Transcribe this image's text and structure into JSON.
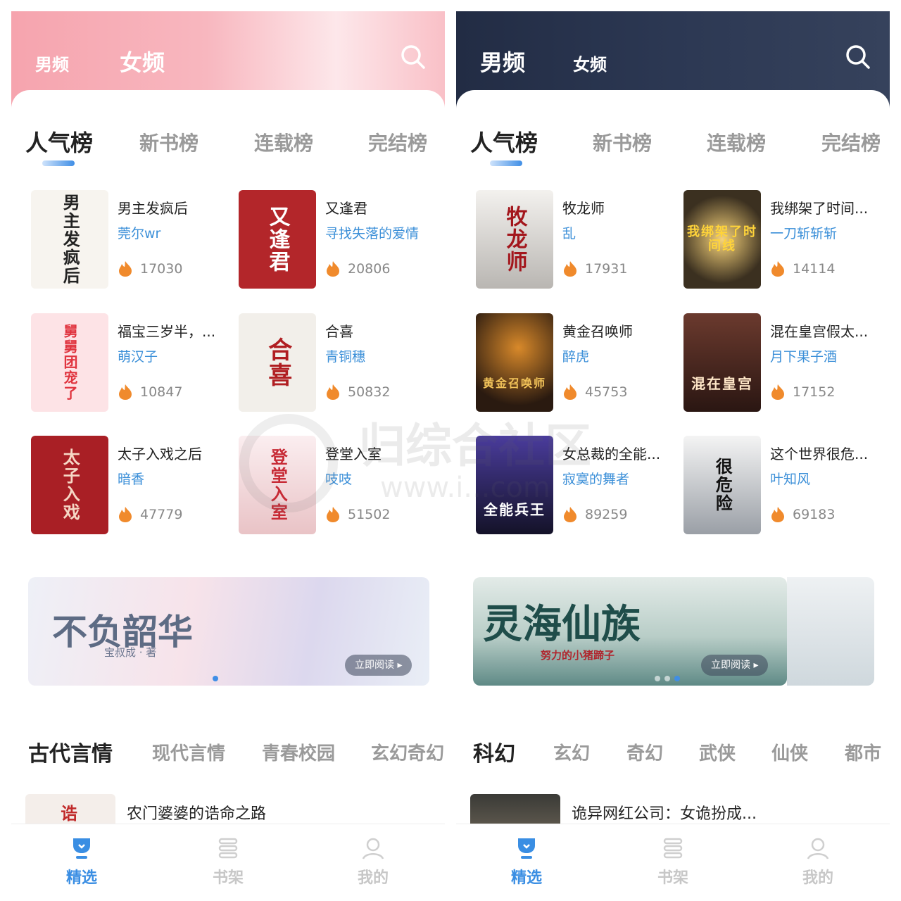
{
  "colors": {
    "accent": "#3a8ee3",
    "female_header": "#f6a4ae",
    "male_header": "#222c44",
    "heat": "#f08a2c"
  },
  "watermark": {
    "text": "归综合社区",
    "url": "www.i...com"
  },
  "panels": [
    {
      "gender_tabs": [
        "男频",
        "女频"
      ],
      "active_gender": "女频",
      "rank_tabs": [
        "人气榜",
        "新书榜",
        "连载榜",
        "完结榜"
      ],
      "books": [
        {
          "title": "男主发疯后",
          "author": "莞尔wr",
          "heat": "17030",
          "cover_text": "男主发疯后"
        },
        {
          "title": "又逢君",
          "author": "寻找失落的爱情",
          "heat": "20806",
          "cover_text": "又逢君"
        },
        {
          "title": "福宝三岁半，...",
          "author": "萌汉子",
          "heat": "10847",
          "cover_text": "舅舅团宠了"
        },
        {
          "title": "合喜",
          "author": "青铜穗",
          "heat": "50832",
          "cover_text": "合喜"
        },
        {
          "title": "太子入戏之后",
          "author": "暗香",
          "heat": "47779",
          "cover_text": "太子入戏"
        },
        {
          "title": "登堂入室",
          "author": "吱吱",
          "heat": "51502",
          "cover_text": "登堂入室"
        }
      ],
      "banner": {
        "title": "不负韶华",
        "subtitle": "宝叔成 · 著",
        "button": "立即阅读 ▸"
      },
      "categories": [
        "古代言情",
        "现代言情",
        "青春校园",
        "玄幻奇幻"
      ],
      "peek": {
        "title": "农门婆婆的诰命之路",
        "cover_text": "诰"
      },
      "nav": [
        "精选",
        "书架",
        "我的"
      ]
    },
    {
      "gender_tabs": [
        "男频",
        "女频"
      ],
      "active_gender": "男频",
      "rank_tabs": [
        "人气榜",
        "新书榜",
        "连载榜",
        "完结榜"
      ],
      "books": [
        {
          "title": "牧龙师",
          "author": "乱",
          "heat": "17931",
          "cover_text": "牧龙师"
        },
        {
          "title": "我绑架了时间...",
          "author": "一刀斩斩斩",
          "heat": "14114",
          "cover_text": "我绑架了时间线"
        },
        {
          "title": "黄金召唤师",
          "author": "醉虎",
          "heat": "45753",
          "cover_text": "黄金召唤师"
        },
        {
          "title": "混在皇宫假太...",
          "author": "月下果子酒",
          "heat": "17152",
          "cover_text": "混在皇宫"
        },
        {
          "title": "女总裁的全能...",
          "author": "寂寞的舞者",
          "heat": "89259",
          "cover_text": "全能兵王"
        },
        {
          "title": "这个世界很危...",
          "author": "叶知风",
          "heat": "69183",
          "cover_text": "很危险"
        }
      ],
      "banner": {
        "title": "灵海仙族",
        "subtitle": "努力的小猪蹄子",
        "button": "立即阅读 ▸"
      },
      "categories": [
        "科幻",
        "玄幻",
        "奇幻",
        "武侠",
        "仙侠",
        "都市"
      ],
      "peek": {
        "title": "诡异网红公司：女诡扮成..."
      },
      "nav": [
        "精选",
        "书架",
        "我的"
      ]
    }
  ]
}
